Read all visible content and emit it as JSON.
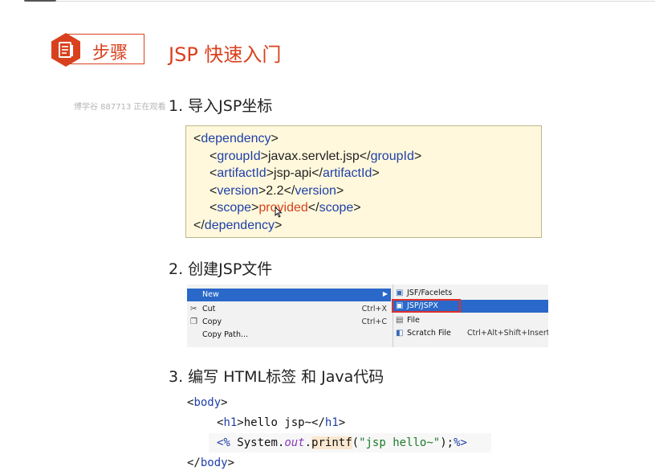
{
  "header": {
    "badge_label": "步骤",
    "badge_icon": "document-icon",
    "title": "JSP 快速入门"
  },
  "watermark": "博学谷 887713 正在观看",
  "steps": [
    {
      "label": "1. 导入JSP坐标"
    },
    {
      "label": "2. 创建JSP文件"
    },
    {
      "label": "3. 编写 HTML标签 和 Java代码"
    }
  ],
  "xml": {
    "dependency_open": "dependency",
    "groupId_tag": "groupId",
    "groupId_value": "javax.servlet.jsp",
    "artifactId_tag": "artifactId",
    "artifactId_value": "jsp-api",
    "version_tag": "version",
    "version_value": "2.2",
    "scope_tag": "scope",
    "scope_value": "provided",
    "dependency_close": "dependency"
  },
  "context_menu": {
    "left_items": [
      {
        "label": "New",
        "shortcut": "",
        "selected": true
      },
      {
        "label": "Cut",
        "shortcut": "Ctrl+X",
        "icon": "scissors-icon"
      },
      {
        "label": "Copy",
        "shortcut": "Ctrl+C",
        "icon": "copy-icon"
      },
      {
        "label": "Copy Path...",
        "shortcut": ""
      }
    ],
    "submenu_items": [
      {
        "label": "JSF/Facelets",
        "shortcut": ""
      },
      {
        "label": "JSP/JSPX",
        "shortcut": "",
        "selected": true
      },
      {
        "label": "File",
        "shortcut": ""
      },
      {
        "label": "Scratch File",
        "shortcut": "Ctrl+Alt+Shift+Insert"
      }
    ]
  },
  "code": {
    "body_tag": "body",
    "h1_tag": "h1",
    "h1_text": "hello jsp~",
    "jsp_open": "<%",
    "stmt_prefix": "System.",
    "stmt_out": "out",
    "stmt_method": "printf",
    "stmt_string": "\"jsp hello~\"",
    "jsp_close": "%>"
  },
  "colors": {
    "accent": "#d9411e",
    "xml_tag": "#1e3fa8",
    "menu_selection": "#2a68c9",
    "code_box_bg": "#fff8dc"
  }
}
